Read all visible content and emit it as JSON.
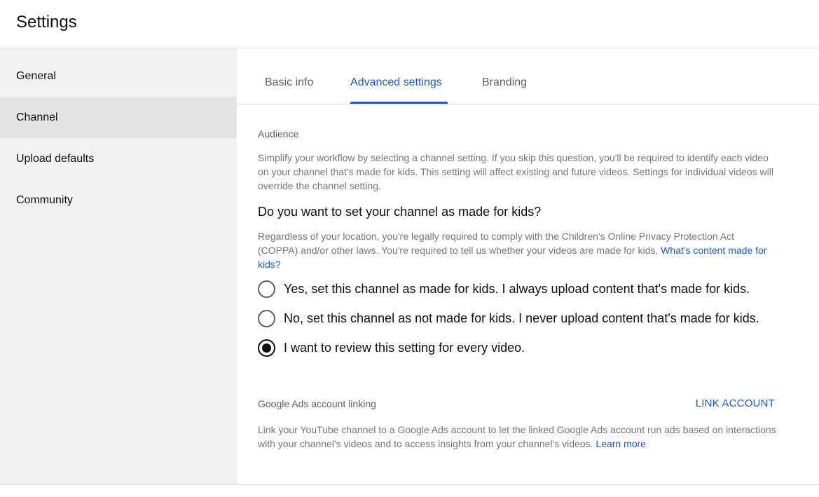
{
  "header": {
    "title": "Settings"
  },
  "sidebar": {
    "items": [
      {
        "label": "General",
        "active": false
      },
      {
        "label": "Channel",
        "active": true
      },
      {
        "label": "Upload defaults",
        "active": false
      },
      {
        "label": "Community",
        "active": false
      }
    ]
  },
  "tabs": [
    {
      "label": "Basic info",
      "active": false
    },
    {
      "label": "Advanced settings",
      "active": true
    },
    {
      "label": "Branding",
      "active": false
    }
  ],
  "audience": {
    "heading": "Audience",
    "description": "Simplify your workflow by selecting a channel setting. If you skip this question, you'll be required to identify each video on your channel that's made for kids. This setting will affect existing and future videos. Settings for individual videos will override the channel setting.",
    "question": "Do you want to set your channel as made for kids?",
    "coppa_text": "Regardless of your location, you're legally required to comply with the Children's Online Privacy Protection Act (COPPA) and/or other laws. You're required to tell us whether your videos are made for kids. ",
    "coppa_link": "What's content made for kids?",
    "options": [
      {
        "label": "Yes, set this channel as made for kids. I always upload content that's made for kids.",
        "checked": false
      },
      {
        "label": "No, set this channel as not made for kids. I never upload content that's made for kids.",
        "checked": false
      },
      {
        "label": "I want to review this setting for every video.",
        "checked": true
      }
    ]
  },
  "ads": {
    "heading": "Google Ads account linking",
    "button": "LINK ACCOUNT",
    "description": "Link your YouTube channel to a Google Ads account to let the linked Google Ads account run ads based on interactions with your channel's videos and to access insights from your channel's videos. ",
    "learn_more": "Learn more"
  },
  "colors": {
    "accent": "#1a59d6",
    "sidebar_bg": "#f1f1f1",
    "sidebar_active": "#e3e3e3",
    "muted_text": "#757575"
  }
}
